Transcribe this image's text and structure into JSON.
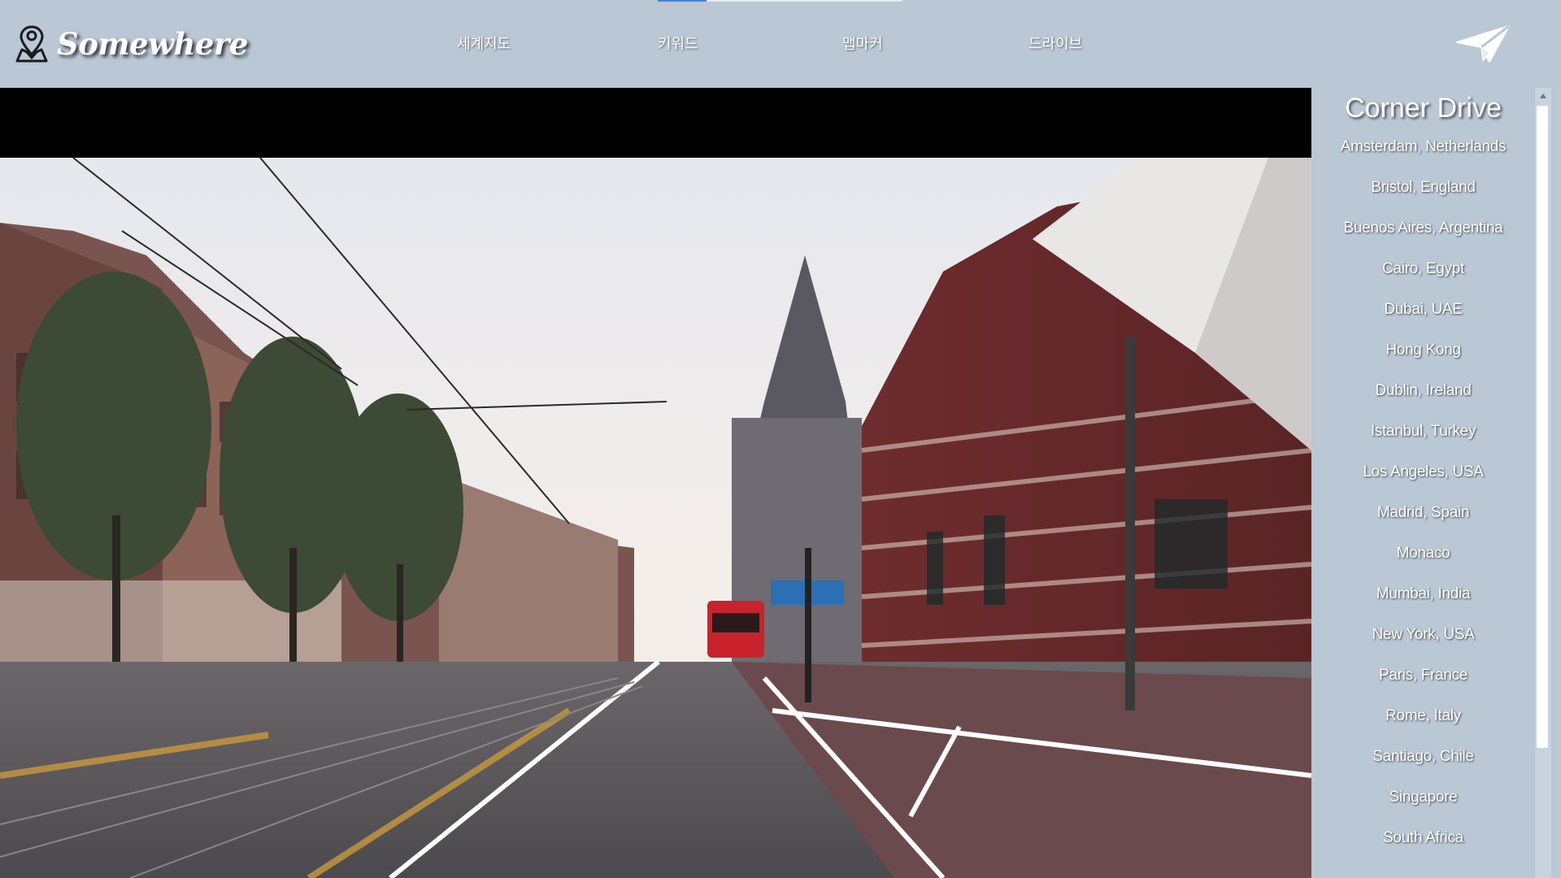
{
  "app": {
    "name": "Somewhere"
  },
  "nav": {
    "items": [
      {
        "label": "세계지도"
      },
      {
        "label": "키워드"
      },
      {
        "label": "맵마커"
      },
      {
        "label": "드라이브"
      }
    ]
  },
  "header": {
    "send_icon": "paper-plane-icon",
    "logo_icon": "map-pin-person-icon"
  },
  "sidebar": {
    "title": "Corner Drive",
    "cities": [
      "Amsterdam, Netherlands",
      "Bristol, England",
      "Buenos Aires, Argentina",
      "Cairo, Egypt",
      "Dubai, UAE",
      "Hong Kong",
      "Dublin, Ireland",
      "Istanbul, Turkey",
      "Los Angeles, USA",
      "Madrid, Spain",
      "Monaco",
      "Mumbai, India",
      "New York, USA",
      "Paris, France",
      "Rome, Italy",
      "Santiago, Chile",
      "Singapore",
      "South Africa"
    ]
  },
  "colors": {
    "background": "#bac7d5",
    "text": "#ffffff",
    "nav_active": "#4a7fd1"
  }
}
